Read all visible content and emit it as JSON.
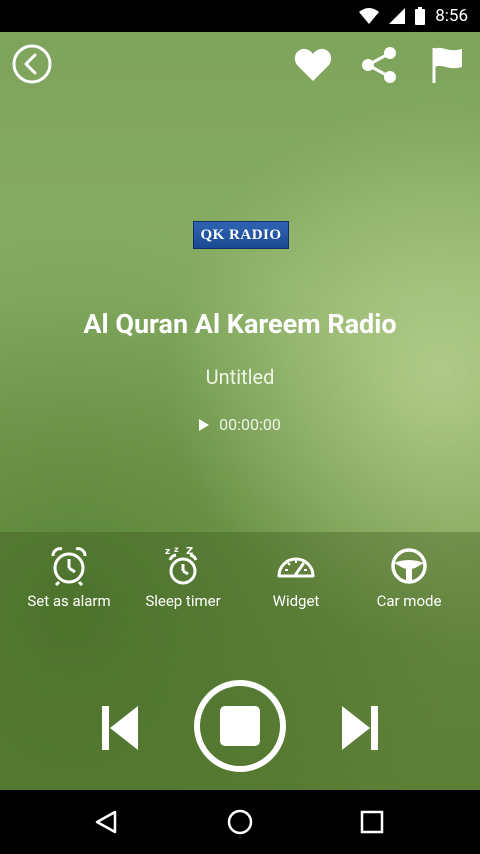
{
  "status_bar": {
    "time": "8:56"
  },
  "logo": {
    "text": "QK RADIO"
  },
  "station": {
    "name": "Al Quran Al Kareem Radio",
    "track": "Untitled",
    "elapsed": "00:00:00"
  },
  "tools": {
    "alarm_label": "Set as alarm",
    "sleep_label": "Sleep timer",
    "widget_label": "Widget",
    "car_label": "Car mode"
  },
  "icons": {
    "back": "back-circle-icon",
    "favorite": "heart-icon",
    "share": "share-icon",
    "report": "flag-icon",
    "play": "play-icon",
    "alarm": "alarm-clock-icon",
    "sleep": "sleep-clock-icon",
    "widget": "speedometer-icon",
    "car": "steering-wheel-icon",
    "previous": "skip-previous-icon",
    "stop": "stop-icon",
    "next": "skip-next-icon"
  },
  "colors": {
    "background": "#7ea35b",
    "logo_blue": "#1b4a92"
  }
}
